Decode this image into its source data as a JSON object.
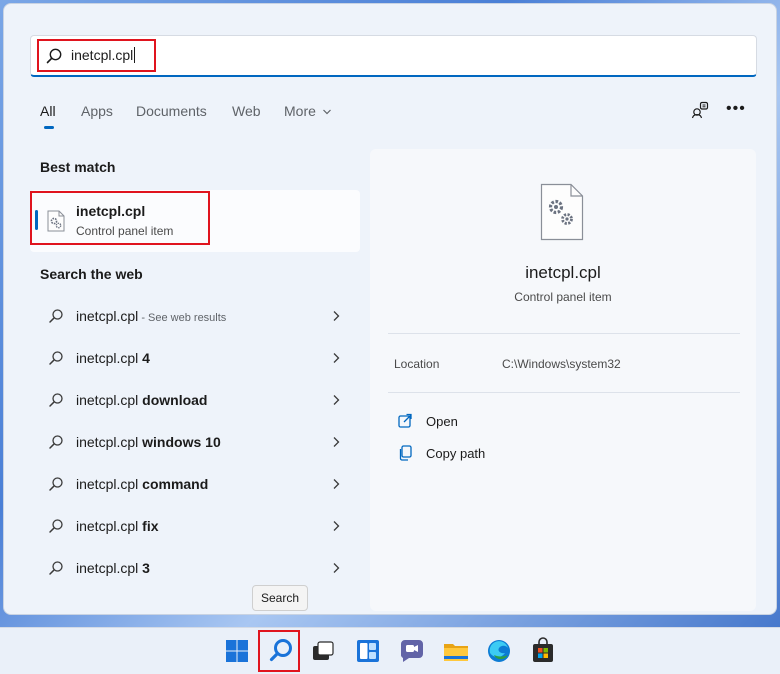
{
  "search": {
    "query": "inetcpl.cpl"
  },
  "tabs": [
    {
      "label": "All",
      "active": true
    },
    {
      "label": "Apps"
    },
    {
      "label": "Documents"
    },
    {
      "label": "Web"
    },
    {
      "label": "More"
    }
  ],
  "best_match": {
    "section_title": "Best match",
    "name": "inetcpl.cpl",
    "subtitle": "Control panel item"
  },
  "search_web": {
    "section_title": "Search the web",
    "items": [
      {
        "prefix": "inetcpl.cpl",
        "suffix": "",
        "hint": " - See web results"
      },
      {
        "prefix": "inetcpl.cpl ",
        "suffix": "4",
        "hint": ""
      },
      {
        "prefix": "inetcpl.cpl ",
        "suffix": "download",
        "hint": ""
      },
      {
        "prefix": "inetcpl.cpl ",
        "suffix": "windows 10",
        "hint": ""
      },
      {
        "prefix": "inetcpl.cpl ",
        "suffix": "command",
        "hint": ""
      },
      {
        "prefix": "inetcpl.cpl ",
        "suffix": "fix",
        "hint": ""
      },
      {
        "prefix": "inetcpl.cpl ",
        "suffix": "3",
        "hint": ""
      }
    ]
  },
  "detail": {
    "name": "inetcpl.cpl",
    "subtitle": "Control panel item",
    "location_label": "Location",
    "location_value": "C:\\Windows\\system32",
    "actions": [
      {
        "label": "Open",
        "icon": "open-external-icon"
      },
      {
        "label": "Copy path",
        "icon": "copy-icon"
      }
    ]
  },
  "tooltip": "Search",
  "taskbar": {
    "icons": [
      "start-icon",
      "search-icon",
      "task-view-icon",
      "widgets-icon",
      "chat-icon",
      "file-explorer-icon",
      "edge-icon",
      "store-icon"
    ]
  },
  "colors": {
    "accent": "#0067c0",
    "highlight": "#e0141e"
  }
}
